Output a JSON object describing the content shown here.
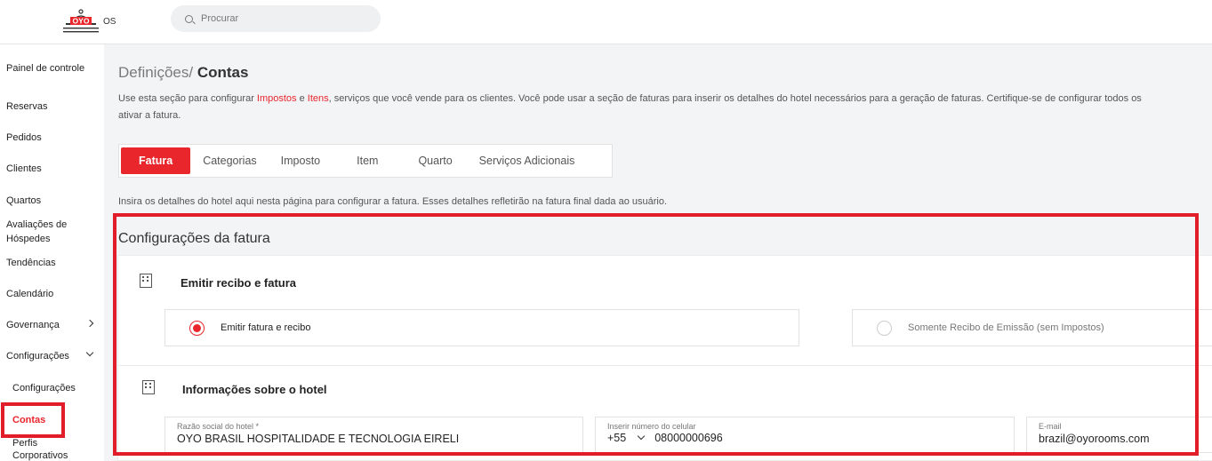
{
  "brand": {
    "logo_text": "OYO",
    "logo_suffix": "OS",
    "accent": "#e8262c",
    "highlight": "#e11d2a"
  },
  "search": {
    "placeholder": "Procurar",
    "icon": "search-icon"
  },
  "sidebar": {
    "items": [
      {
        "label": "Painel de controle"
      },
      {
        "label": "Reservas"
      },
      {
        "label": "Pedidos"
      },
      {
        "label": "Clientes"
      },
      {
        "label": "Quartos"
      },
      {
        "label": "Avaliações de Hóspedes"
      },
      {
        "label": "Tendências"
      },
      {
        "label": "Calendário"
      },
      {
        "label": "Governança",
        "icon": "chevron-right-icon"
      },
      {
        "label": "Configurações",
        "icon": "chevron-down-icon"
      }
    ],
    "sub_items": [
      {
        "label": "Configurações"
      },
      {
        "label": "Contas",
        "active": true
      },
      {
        "label": "Perfis Corporativos"
      }
    ]
  },
  "page": {
    "breadcrumb_parent": "Definições",
    "separator": "/",
    "breadcrumb_current": "Contas",
    "desc_1": "Use esta seção para configurar ",
    "desc_link1": "Impostos",
    "desc_2": " e ",
    "desc_link2": "Itens",
    "desc_3": ", serviços que você vende para os clientes. Você pode usar a seção de faturas para inserir os detalhes do hotel necessários para a geração de faturas. Certifique-se de configurar todos os",
    "desc_4": "ativar a fatura."
  },
  "tabs": [
    {
      "label": "Fatura",
      "active": true
    },
    {
      "label": "Categorias"
    },
    {
      "label": "Imposto"
    },
    {
      "label": "Item"
    },
    {
      "label": "Quarto"
    },
    {
      "label": "Serviços Adicionais"
    }
  ],
  "hint": "Insira os detalhes do hotel aqui nesta página para configurar a fatura. Esses detalhes refletirão na fatura final dada ao usuário.",
  "invoice": {
    "section_title": "Configurações da fatura",
    "emit": {
      "title": "Emitir recibo e fatura",
      "icon": "building-icon",
      "options": [
        {
          "label": "Emitir fatura e recibo",
          "selected": true
        },
        {
          "label": "Somente Recibo de Emissão (sem Impostos)",
          "selected": false
        }
      ]
    },
    "hotel": {
      "title": "Informações sobre o hotel",
      "icon": "building-icon",
      "company_label": "Razão social do hotel *",
      "company_value": "OYO BRASIL HOSPITALIDADE E TECNOLOGIA EIRELI",
      "phone_label": "Inserir número do celular",
      "phone_code": "+55",
      "phone_value": "08000000696",
      "email_label": "E-mail",
      "email_value": "brazil@oyorooms.com"
    }
  }
}
